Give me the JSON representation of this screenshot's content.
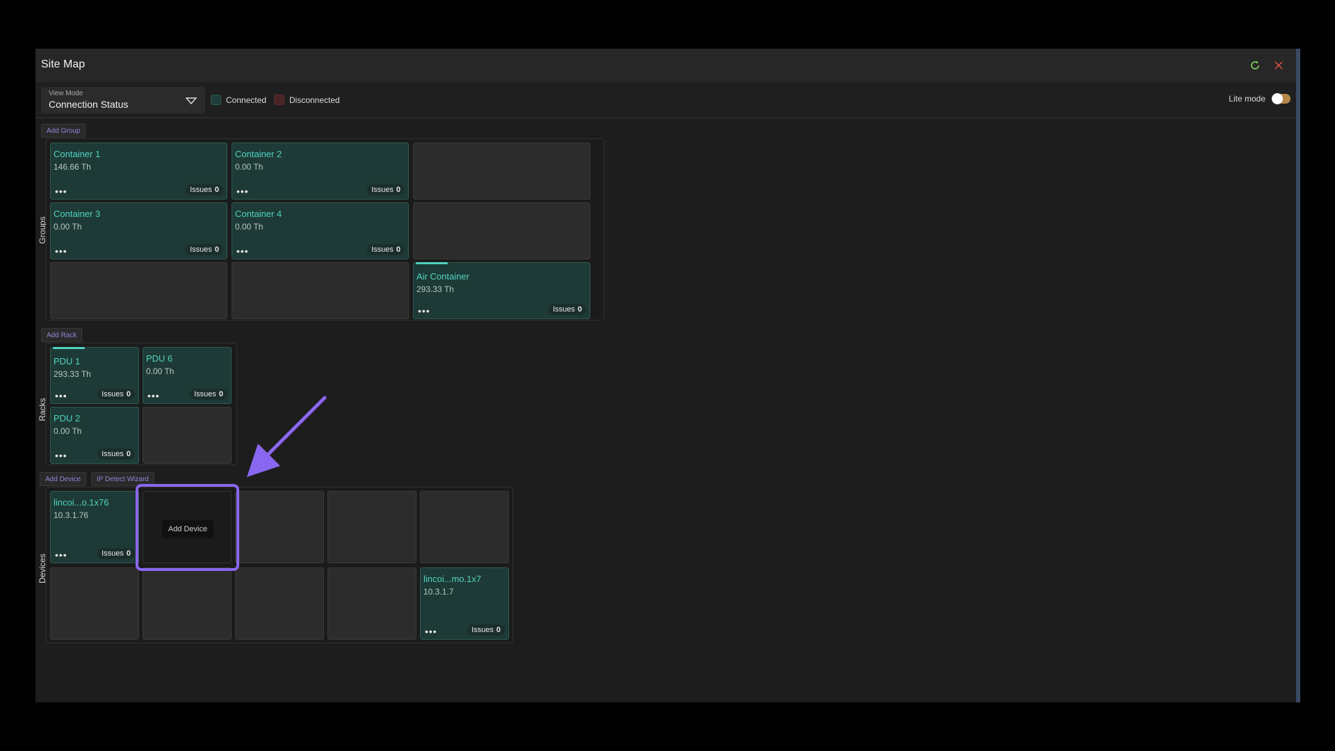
{
  "window": {
    "title": "Site Map"
  },
  "toolbar": {
    "view_mode_label": "View Mode",
    "view_mode_value": "Connection Status",
    "legend": [
      {
        "label": "Connected",
        "color": "#1f3d3a"
      },
      {
        "label": "Disconnected",
        "color": "#4a2424"
      }
    ],
    "lite_mode_label": "Lite mode",
    "lite_mode_on": true
  },
  "groups": {
    "section_label": "Groups",
    "add_label": "Add Group",
    "cards": [
      {
        "name": "Container 1",
        "value": "146.66 Th",
        "issues_label": "Issues",
        "issues": "0"
      },
      {
        "name": "Container 2",
        "value": "0.00 Th",
        "issues_label": "Issues",
        "issues": "0"
      },
      {
        "name": "Container 3",
        "value": "0.00 Th",
        "issues_label": "Issues",
        "issues": "0"
      },
      {
        "name": "Container 4",
        "value": "0.00 Th",
        "issues_label": "Issues",
        "issues": "0"
      },
      {
        "name": "Air Container",
        "value": "293.33 Th",
        "issues_label": "Issues",
        "issues": "0"
      }
    ]
  },
  "racks": {
    "section_label": "Racks",
    "add_label": "Add Rack",
    "cards": [
      {
        "name": "PDU 1",
        "value": "293.33 Th",
        "issues_label": "Issues",
        "issues": "0"
      },
      {
        "name": "PDU 6",
        "value": "0.00 Th",
        "issues_label": "Issues",
        "issues": "0"
      },
      {
        "name": "PDU 2",
        "value": "0.00 Th",
        "issues_label": "Issues",
        "issues": "0"
      }
    ]
  },
  "devices": {
    "section_label": "Devices",
    "add_label": "Add Device",
    "wizard_label": "IP Detect Wizard",
    "add_cell_label": "Add Device",
    "cards": [
      {
        "name": "lincoi...o.1x76",
        "value": "10.3.1.76",
        "issues_label": "Issues",
        "issues": "0"
      },
      {
        "name": "lincoi...mo.1x7",
        "value": "10.3.1.7",
        "issues_label": "Issues",
        "issues": "0"
      }
    ]
  },
  "colors": {
    "accent": "#4fd3c0",
    "highlight": "#8a67f0",
    "card_bg": "#1e3a36"
  }
}
